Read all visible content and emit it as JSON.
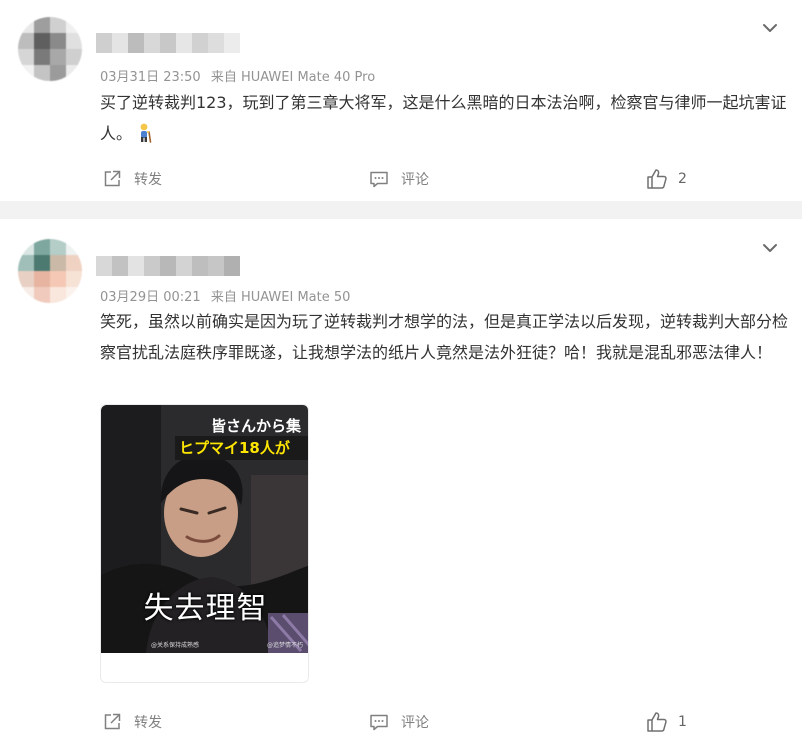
{
  "colors": {
    "page_bg": "#f2f2f2",
    "card_bg": "#ffffff",
    "meta_text": "#939393",
    "action_text": "#808080",
    "body_text": "#333333"
  },
  "posts": [
    {
      "meta": {
        "date": "03月31日 23:50",
        "source": "来自 HUAWEI Mate 40 Pro"
      },
      "content": "买了逆转裁判123，玩到了第三章大将军，这是什么黑暗的日本法治啊，检察官与律师一起坑害证人。",
      "emoji": "man-with-cane-emoji",
      "actions": {
        "repost_label": "转发",
        "comment_label": "评论",
        "like_count": "2"
      }
    },
    {
      "meta": {
        "date": "03月29日 00:21",
        "source": "来自 HUAWEI Mate 50"
      },
      "content": "笑死，虽然以前确实是因为玩了逆转裁判才想学的法，但是真正学法以后发现，逆转裁判大部分检察官扰乱法庭秩序罪既遂，让我想学法的纸片人竟然是法外狂徒？哈！我就是混乱邪恶法律人！",
      "image": {
        "overlay_line1": "皆さんから集",
        "overlay_line2": "ヒプマイ18人が",
        "caption": "失去理智",
        "watermark_left": "@关系保持成熟感",
        "watermark_right": "@追梦情不朽"
      },
      "actions": {
        "repost_label": "转发",
        "comment_label": "评论",
        "like_count": "1"
      }
    }
  ],
  "icons": {
    "chevron": "chevron-down-icon",
    "repost": "share-external-icon",
    "comment": "comment-bubble-icon",
    "like": "thumbs-up-icon"
  }
}
